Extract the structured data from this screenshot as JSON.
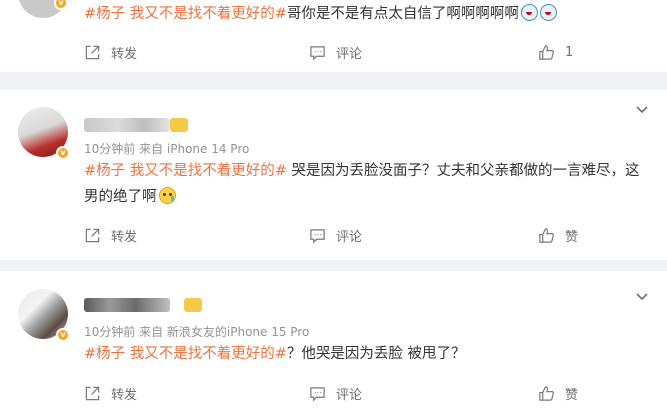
{
  "colors": {
    "topic": "#eb7340",
    "meta": "#939393",
    "background": "#f1f2f5"
  },
  "top_post": {
    "topic": "#杨子 我又不是找不着更好的#",
    "body": "哥你是不是有点太自信了啊啊啊啊啊",
    "emojis": [
      "cry-emoji",
      "cry-emoji"
    ],
    "actions": {
      "repost": "转发",
      "comment": "评论",
      "like_count": "1"
    }
  },
  "comments": [
    {
      "meta": "10分钟前 来自 iPhone 14 Pro",
      "topic": "#杨子 我又不是找不着更好的#",
      "body_line1": " 哭是因为丢脸没面子？丈夫和父亲都做的一言难尽，这",
      "body_line2": "男的绝了啊",
      "emoji": "sad-emoji",
      "actions": {
        "repost": "转发",
        "comment": "评论",
        "like": "赞"
      }
    },
    {
      "meta": "10分钟前 来自 新浪女友的iPhone 15 Pro",
      "topic": "#杨子 我又不是找不着更好的#",
      "body": "？他哭是因为丢脸 被甩了？",
      "actions": {
        "repost": "转发",
        "comment": "评论",
        "like": "赞"
      }
    }
  ]
}
